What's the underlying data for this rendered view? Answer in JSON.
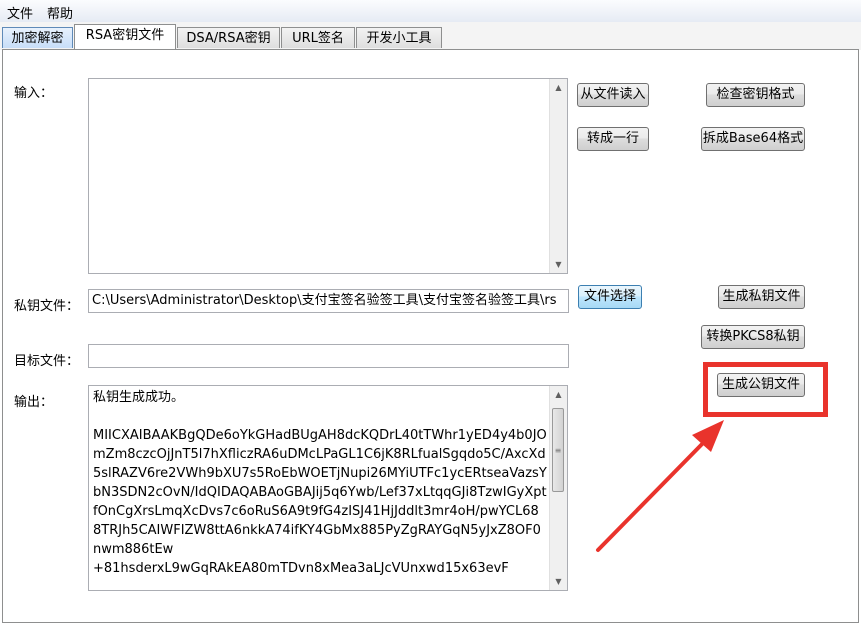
{
  "menu": {
    "file": "文件",
    "help": "帮助"
  },
  "tabs": [
    {
      "label": "加密解密"
    },
    {
      "label": "RSA密钥文件"
    },
    {
      "label": "DSA/RSA密钥"
    },
    {
      "label": "URL签名"
    },
    {
      "label": "开发小工具"
    }
  ],
  "labels": {
    "input": "输入：",
    "private_key_file": "私钥文件：",
    "target_file": "目标文件：",
    "output": "输出："
  },
  "buttons": {
    "read_from_file": "从文件读入",
    "check_key_format": "检查密钥格式",
    "to_one_line": "转成一行",
    "split_base64": "拆成Base64格式",
    "choose_file": "文件选择",
    "gen_private_key": "生成私钥文件",
    "convert_pkcs8": "转换PKCS8私钥",
    "gen_public_key": "生成公钥文件"
  },
  "fields": {
    "input_text": "",
    "private_key_path": "C:\\Users\\Administrator\\Desktop\\支付宝签名验签工具\\支付宝签名验签工具\\rs",
    "target_file_path": ""
  },
  "output": {
    "status": "私钥生成成功。",
    "key_lines": "MIICXAIBAAKBgQDe6oYkGHadBUgAH8dcKQDrL40tTWhr1yED4y4b0JOmZm8czcOjJnT5l7hXfliczRA6uDMcLPaGL1C6jK8RLfualSgqdo5C/AxcXd5slRAZV6re2VWh9bXU7s5RoEbWOETjNupi26MYiUTFc1ycERtseaVazsYbN3SDN2cOvN/IdQIDAQABAoGBAJij5q6Ywb/Lef37xLtqqGJi8TzwIGyXptfOnCgXrsLmqXcDvs7c6oRuS6A9t9fG4zISJ41HjJddlt3mr4oH/pwYCL688TRJh5CAIWFIZW8ttA6nkkA74ifKY4GbMx885PyZgRAYGqN5yJxZ8OF0nwm886tEw\n+81hsderxL9wGqRAkEA80mTDvn8xMea3aLJcVUnxwd15x63evF"
  },
  "colors": {
    "annotation": "#e9332c"
  }
}
